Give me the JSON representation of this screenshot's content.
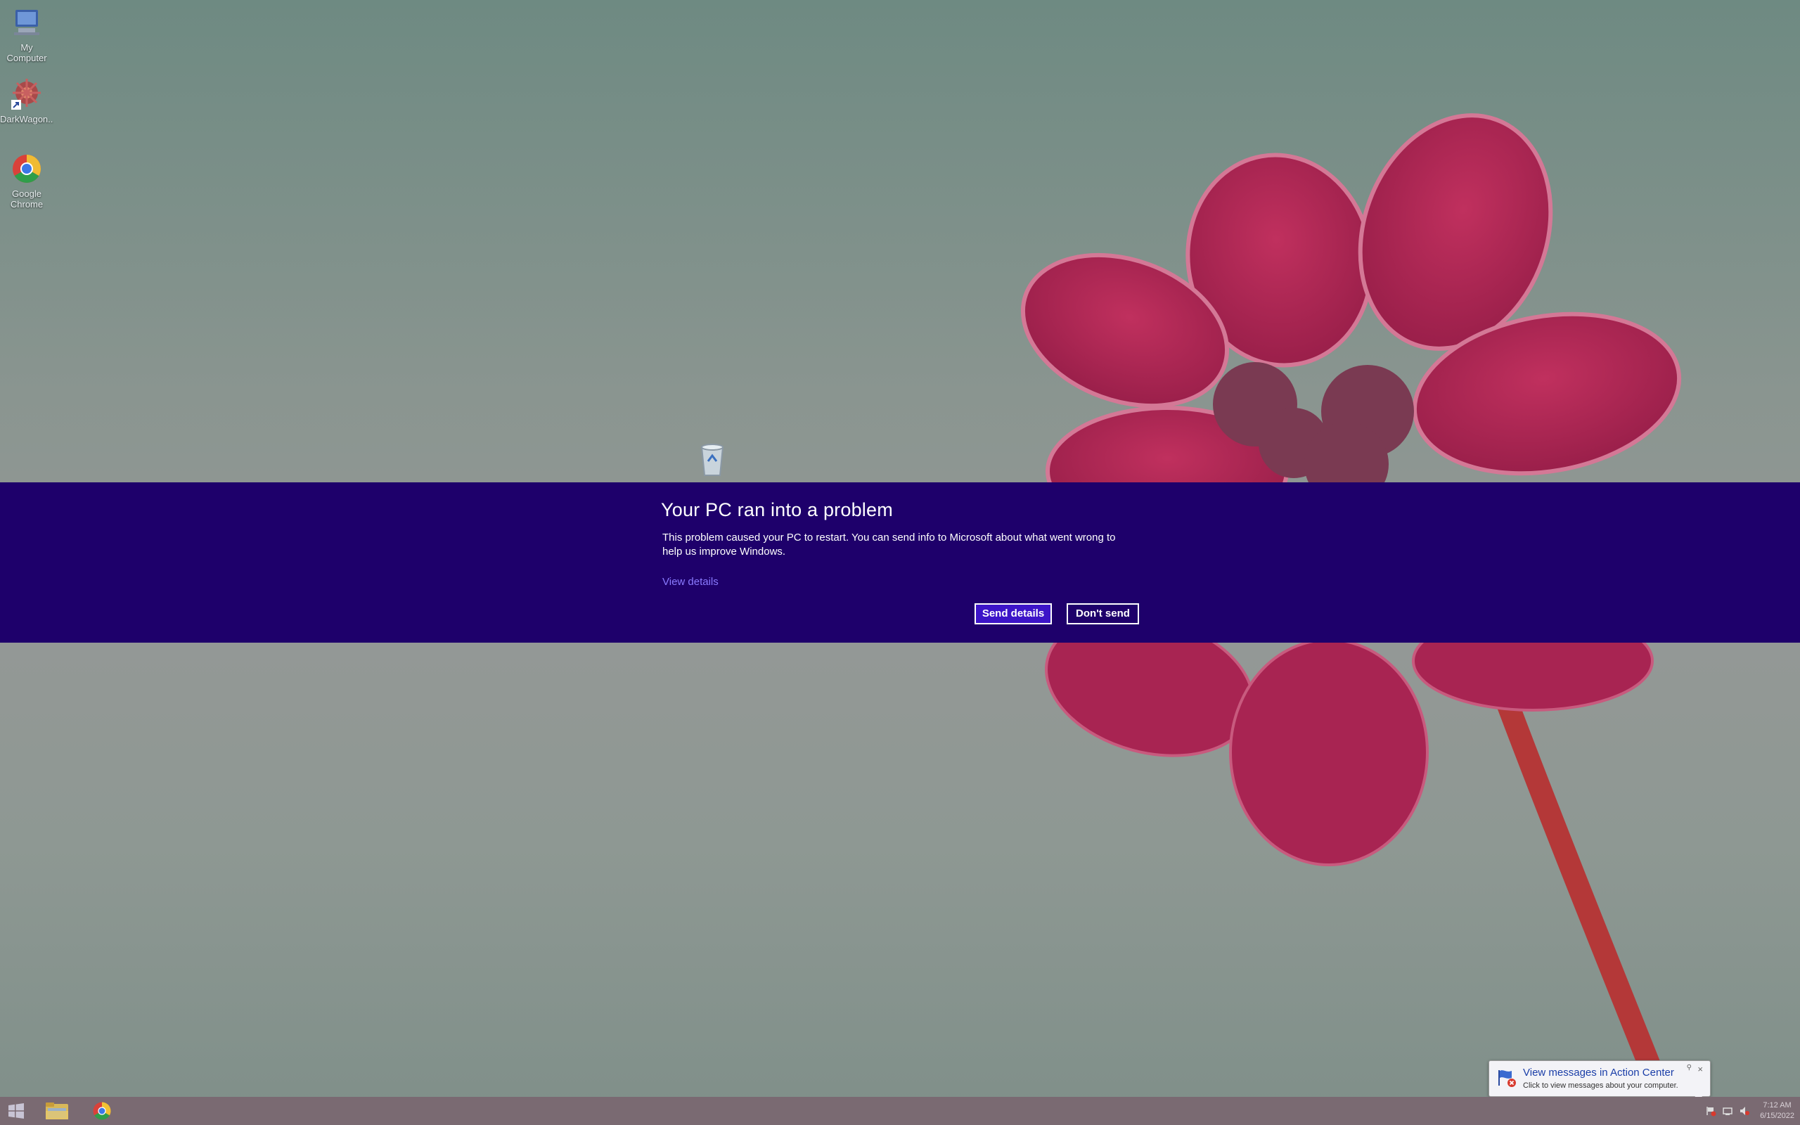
{
  "desktop": {
    "icons": [
      {
        "label": "My Computer",
        "icon": "computer-icon"
      },
      {
        "label": "DarkWagon...",
        "icon": "shortcut-icon"
      },
      {
        "label": "Google Chrome",
        "icon": "chrome-icon"
      }
    ],
    "recycle_bin": {
      "icon": "recycle-bin-icon"
    }
  },
  "banner": {
    "background": "#1e006b",
    "title": "Your PC ran into a problem",
    "message": "This problem caused your PC to restart. You can send info to Microsoft about what went wrong to help us improve Windows.",
    "link": "View details",
    "send_label": "Send details",
    "dont_send_label": "Don't send"
  },
  "toast": {
    "title": "View messages in Action Center",
    "subtitle": "Click to view messages about your computer.",
    "close": "×",
    "icon": "action-center-flag-icon"
  },
  "taskbar": {
    "start_icon": "windows-logo-icon",
    "pinned": [
      {
        "name": "file-explorer",
        "icon": "folder-icon"
      },
      {
        "name": "chrome",
        "icon": "chrome-icon"
      }
    ],
    "tray": {
      "time": "7:12 AM",
      "date": "6/15/2022"
    }
  }
}
